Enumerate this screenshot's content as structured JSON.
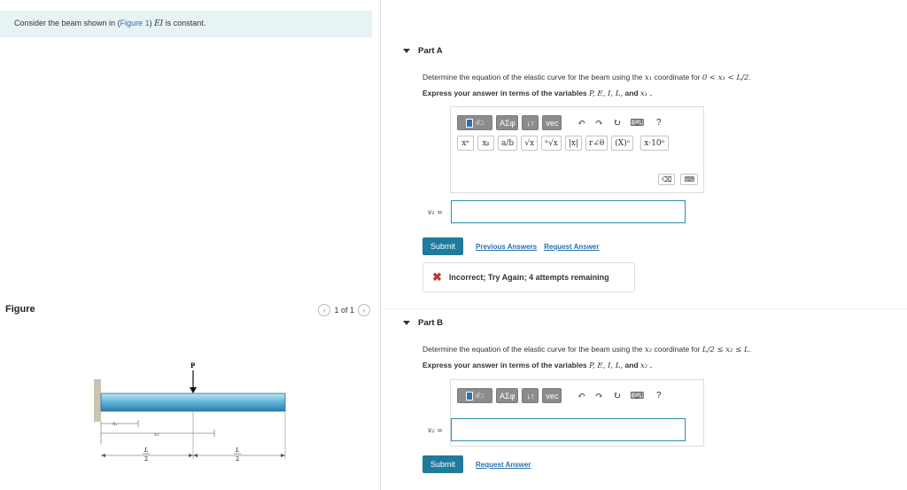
{
  "intro": {
    "prefix": "Consider the beam shown in (",
    "figure_link": "Figure 1",
    "suffix": ") ",
    "ei": "EI",
    "tail": " is constant."
  },
  "figure": {
    "title": "Figure",
    "page_indicator": "1 of 1",
    "labels": {
      "P": "P",
      "x1": "x₁",
      "x2": "x₂",
      "half_num": "L",
      "half_den": "2"
    }
  },
  "partA": {
    "title": "Part A",
    "desc_prefix": "Determine the equation of the elastic curve for the beam using the ",
    "desc_var": "x₁",
    "desc_mid": " coordinate for ",
    "desc_range": "0 < x₁ < L/2",
    "desc_end": ".",
    "express_prefix": "Express your answer in terms of the variables ",
    "express_vars": "P, E, I, L,",
    "express_and": " and ",
    "express_last": "x₁",
    "express_end": " .",
    "toolbar_row1": [
      "ΑΣφ",
      "↓↑",
      "vec",
      "↶",
      "↷",
      "↻",
      "⌨",
      "?"
    ],
    "toolbar_row2": [
      "xᵃ",
      "xᵦ",
      "a/b",
      "√x",
      "ⁿ√x",
      "|x|",
      "r∠θ",
      "(X)ᵒ",
      "x·10ⁿ"
    ],
    "answer_label": "v₁ =",
    "submit": "Submit",
    "previous_answers": "Previous Answers",
    "request_answer": "Request Answer",
    "feedback": "Incorrect; Try Again; 4 attempts remaining"
  },
  "partB": {
    "title": "Part B",
    "desc_prefix": "Determine the equation of the elastic curve for the beam using the ",
    "desc_var": "x₂",
    "desc_mid": " coordinate for ",
    "desc_range": "L/2 ≤ x₂ ≤ L",
    "desc_end": ".",
    "express_prefix": "Express your answer in terms of the variables ",
    "express_vars": "P, E, I, L,",
    "express_and": " and ",
    "express_last": "x₂",
    "express_end": " .",
    "toolbar_row1": [
      "ΑΣφ",
      "↓↑",
      "vec",
      "↶",
      "↷",
      "↻",
      "⌨",
      "?"
    ],
    "answer_label": "v₂ =",
    "submit": "Submit",
    "request_answer": "Request Answer"
  }
}
